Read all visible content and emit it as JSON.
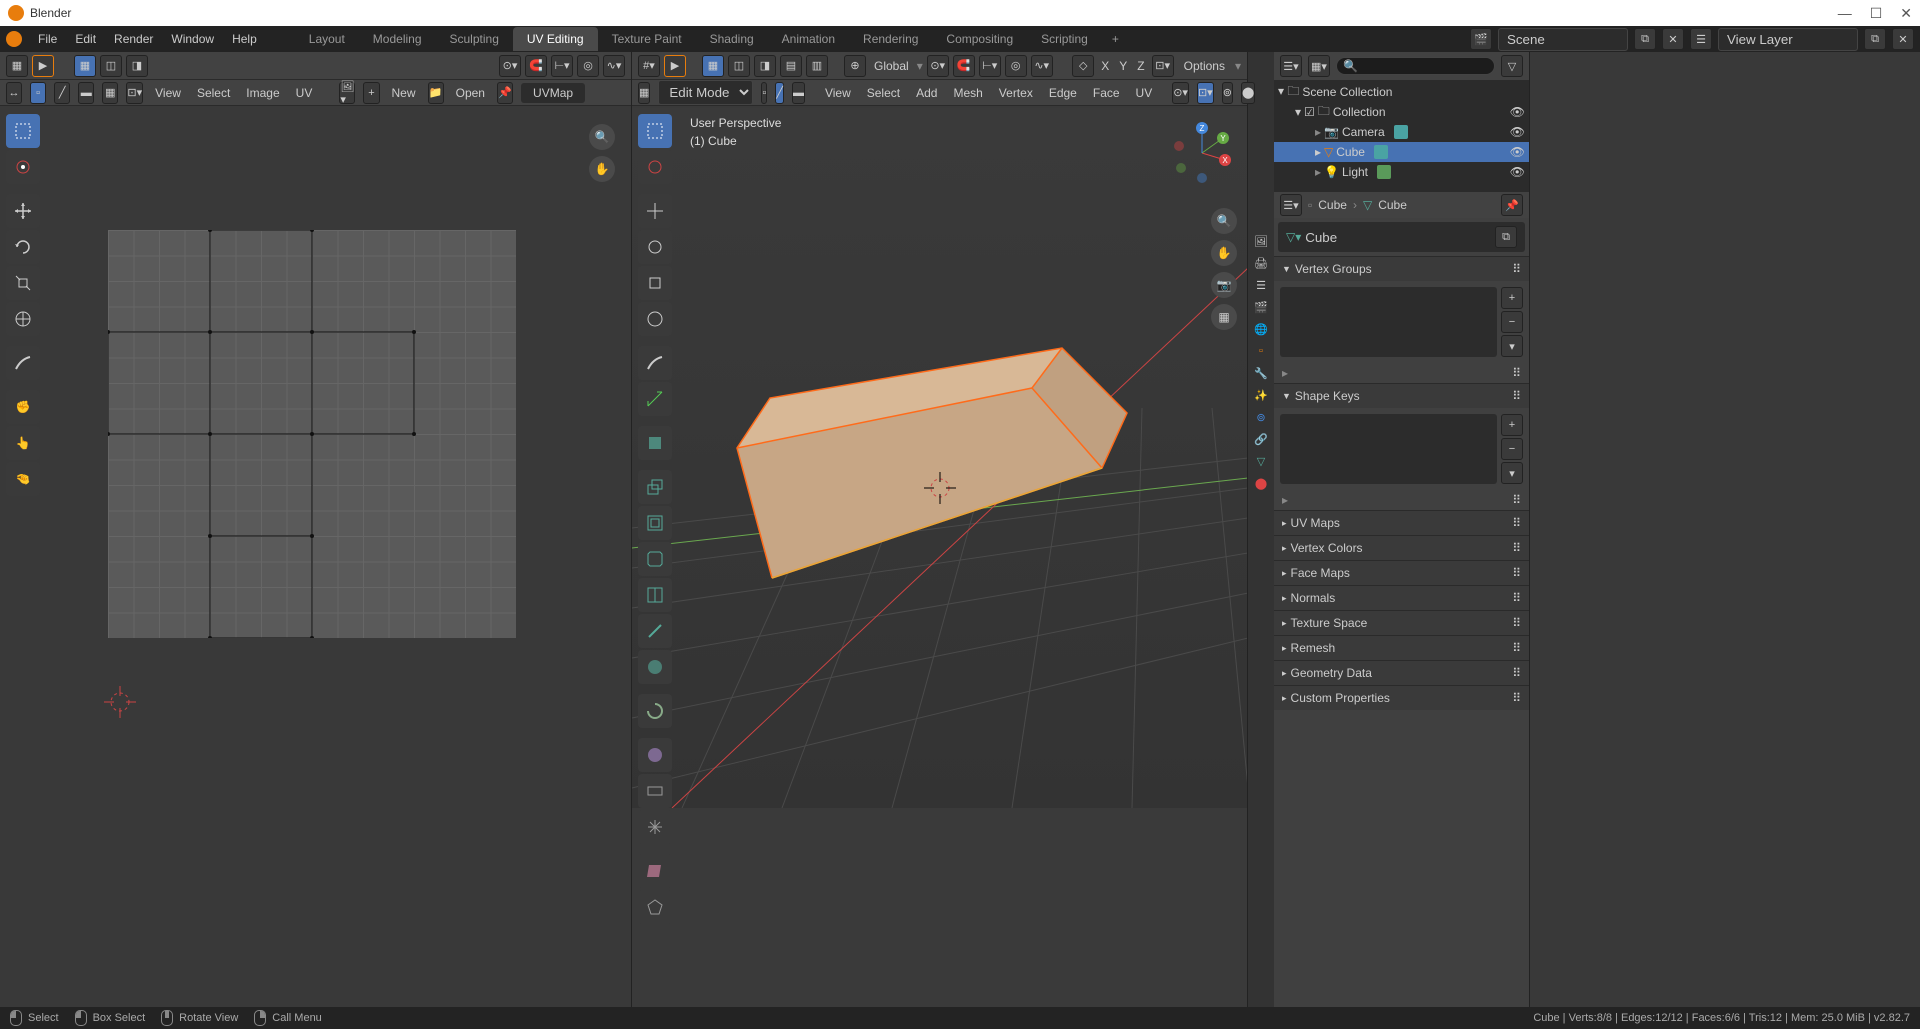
{
  "app": {
    "title": "Blender"
  },
  "window_controls": {
    "min": "—",
    "max": "☐",
    "close": "✕"
  },
  "menus": [
    "File",
    "Edit",
    "Render",
    "Window",
    "Help"
  ],
  "tabs": [
    "Layout",
    "Modeling",
    "Sculpting",
    "UV Editing",
    "Texture Paint",
    "Shading",
    "Animation",
    "Rendering",
    "Compositing",
    "Scripting"
  ],
  "active_tab": "UV Editing",
  "scene": {
    "label": "Scene",
    "view_layer": "View Layer"
  },
  "uv_editor": {
    "menus": [
      "View",
      "Select",
      "Image",
      "UV"
    ],
    "new": "New",
    "open": "Open",
    "map_name": "UVMap"
  },
  "viewport": {
    "mode": "Edit Mode",
    "menus": [
      "View",
      "Select",
      "Add",
      "Mesh",
      "Vertex",
      "Edge",
      "Face",
      "UV"
    ],
    "orientation": "Global",
    "xyz": [
      "X",
      "Y",
      "Z"
    ],
    "options": "Options",
    "info_line1": "User Perspective",
    "info_line2": "(1) Cube"
  },
  "outliner": {
    "scene_collection": "Scene Collection",
    "collection": "Collection",
    "items": [
      {
        "name": "Camera",
        "icon": "📷",
        "badge_color": "#4aa3a3"
      },
      {
        "name": "Cube",
        "icon": "▽",
        "badge_color": "#4aa3a3",
        "selected": true
      },
      {
        "name": "Light",
        "icon": "💡",
        "badge_color": "#5a9a5a"
      }
    ]
  },
  "properties": {
    "breadcrumb_cube": "Cube",
    "object_name": "Cube",
    "sections": [
      "Vertex Groups",
      "Shape Keys",
      "UV Maps",
      "Vertex Colors",
      "Face Maps",
      "Normals",
      "Texture Space",
      "Remesh",
      "Geometry Data",
      "Custom Properties"
    ]
  },
  "status": {
    "select": "Select",
    "box_select": "Box Select",
    "rotate": "Rotate View",
    "call_menu": "Call Menu",
    "stats": "Cube | Verts:8/8 | Edges:12/12 | Faces:6/6 | Tris:12 | Mem: 25.0 MiB | v2.82.7"
  }
}
